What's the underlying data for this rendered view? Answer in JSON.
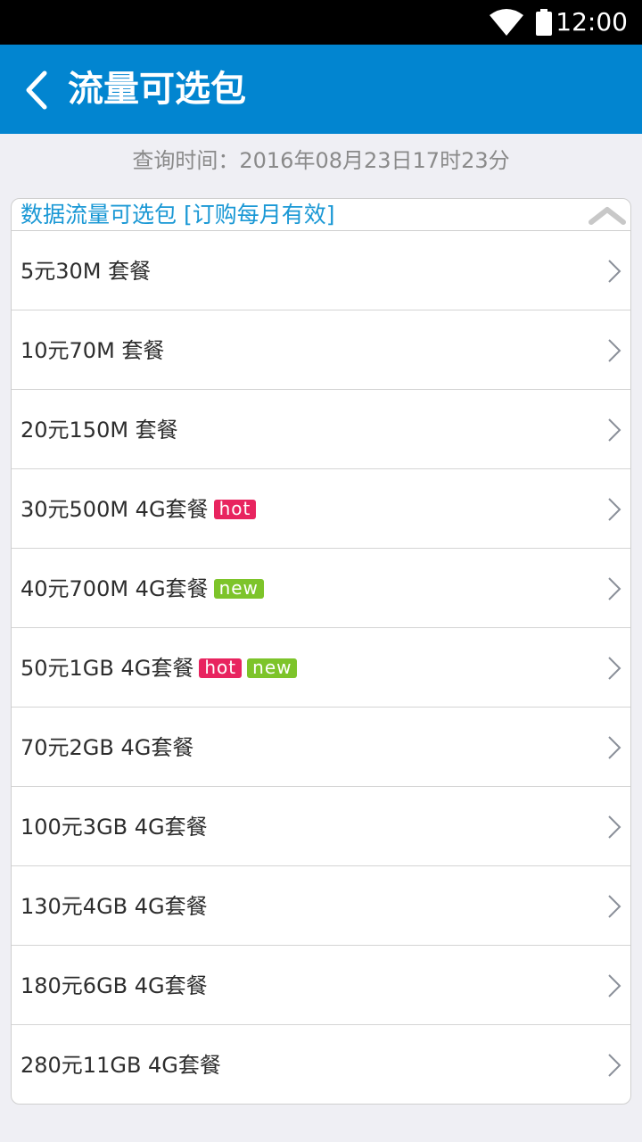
{
  "status_bar": {
    "time": "12:00"
  },
  "header": {
    "title": "流量可选包"
  },
  "query_time": "查询时间：2016年08月23日17时23分",
  "section": {
    "title": "数据流量可选包 [订购每月有效]",
    "items": [
      {
        "label": "5元30M 套餐",
        "badges": []
      },
      {
        "label": "10元70M 套餐",
        "badges": []
      },
      {
        "label": "20元150M 套餐",
        "badges": []
      },
      {
        "label": "30元500M 4G套餐",
        "badges": [
          "hot"
        ]
      },
      {
        "label": "40元700M 4G套餐",
        "badges": [
          "new"
        ]
      },
      {
        "label": "50元1GB 4G套餐",
        "badges": [
          "hot",
          "new"
        ]
      },
      {
        "label": "70元2GB 4G套餐",
        "badges": []
      },
      {
        "label": "100元3GB 4G套餐",
        "badges": []
      },
      {
        "label": "130元4GB 4G套餐",
        "badges": []
      },
      {
        "label": "180元6GB 4G套餐",
        "badges": []
      },
      {
        "label": "280元11GB 4G套餐",
        "badges": []
      }
    ]
  },
  "colors": {
    "app_bar": "#0285d0",
    "hot": "#e8245f",
    "new": "#7dc42a",
    "section_title": "#1a98d5"
  }
}
